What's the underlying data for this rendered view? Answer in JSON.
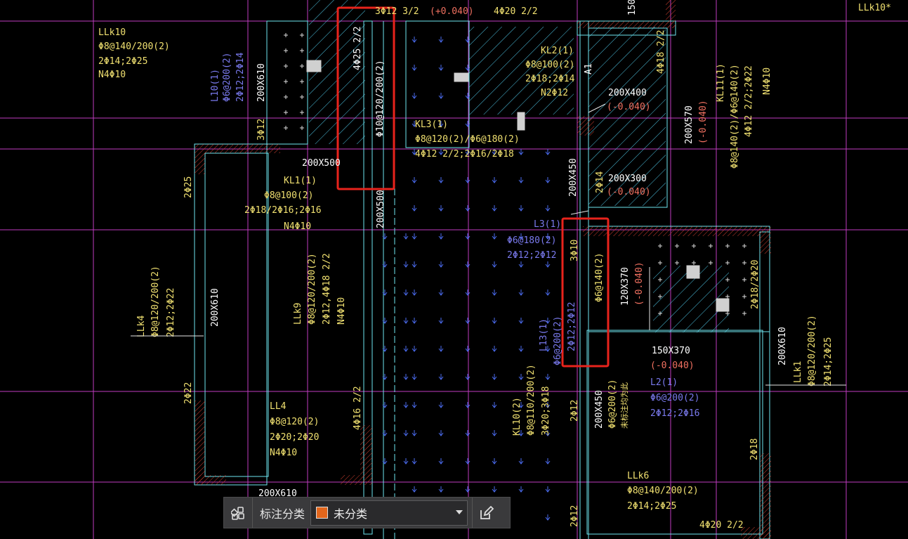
{
  "colors": {
    "background": "#000000",
    "highlight": "#e8231c",
    "category_swatch": "#e2661c"
  },
  "drawing": {
    "top_labels": {
      "left": "3Φ12 3/2",
      "mid": "(+0.040)",
      "right": "4Φ20 2/2",
      "far_right": "LLk10*"
    },
    "beams": {
      "llk10_name": "LLk10",
      "llk10_stirrup": "Φ8@140/200(2)",
      "llk10_bars": "2Φ14;2Φ25",
      "llk10_side": "N4Φ10",
      "l10_name": "L10(1)",
      "l10_stirrup": "Φ6@200(2)",
      "l10_bars": "2Φ12;2Φ14",
      "l10_size": "200X610",
      "kl2_name": "KL2(1)",
      "kl2_stirrup": "Φ8@100(2)",
      "kl2_bars": "2Φ18;2Φ14",
      "kl2_side": "N2Φ12",
      "kl2_bot": "4Φ18 2/2",
      "kl2_size": "200X400",
      "kl2_elev": "(-0.040)",
      "kl11_name": "KL11(1)",
      "kl11_stirrup": "Φ8@140(2)/Φ6@140(2)",
      "kl11_bars": "4Φ12 2/2;2Φ22",
      "kl11_side": "N4Φ10",
      "kl11_size": "200X570",
      "kl11_elev": "(-0.040)",
      "kl3_name": "KL3(1)",
      "kl3_stirrup": "Φ8@120(2)/Φ6@180(2)",
      "kl3_bars": "4Φ12 2/2;2Φ16/2Φ18",
      "hl_top_1": "4Φ25 2/2",
      "hl_top_2": "Φ10@120/200(2)",
      "size_200x500": "200X500",
      "size_200x500_v": "200X500",
      "kl1_name": "KL1(1)",
      "kl1_stirrup": "Φ8@100(2)",
      "kl1_bars": "2Φ18/2Φ16;2Φ16",
      "kl1_side": "N4Φ10",
      "size_200x450": "200X450",
      "bar_2c14": "2Φ14",
      "size_200x300": "200X300",
      "elev_300": "(-0.040)",
      "l3_name": "L3(1)",
      "l3_stirrup": "Φ6@180(2)",
      "l3_bars": "2Φ12;2Φ12",
      "hl_bot_1": "3Φ10",
      "hl_bot_2": "Φ6@140(2)",
      "size_120x370": "120X370",
      "elev_120": "(-0.040)",
      "l13_name": "L13(1)",
      "l13_stirrup": "Φ6@200(2)",
      "l13_bars": "2Φ12;2Φ12",
      "bar_2c18": "2Φ18/2Φ20",
      "size_150x370": "150X370",
      "elev_150": "(-0.040)",
      "l2_name": "L2(1)",
      "l2_stirrup": "Φ6@200(2)",
      "l2_bars": "2Φ12;2Φ16",
      "llk1_name": "LLk1",
      "llk1_stirrup": "Φ8@120/200(2)",
      "llk1_bars": "2Φ14;2Φ25",
      "llk1_size": "200X610",
      "llk4_name": "LLk4",
      "llk4_stirrup": "Φ8@120/200(2)",
      "llk4_bars": "2Φ12;2Φ22",
      "llk4_size": "200X610",
      "bar_2c25": "2Φ25",
      "bar_2c22": "2Φ22",
      "llk9_name": "LLk9",
      "llk9_stirrup": "Φ8@120/200(2)",
      "llk9_bars": "2Φ12,4Φ18 2/2",
      "llk9_side": "N4Φ10",
      "ll4_name": "LL4",
      "ll4_stirrup": "Φ8@120(2)",
      "ll4_bars": "2Φ20;2Φ20",
      "ll4_side": "N4Φ10",
      "bar_4c16": "4Φ16 2/2",
      "size_200x610_bot": "200X610",
      "kl10_name": "KL10(2)",
      "kl10_stirrup": "Φ8@110/200(2)",
      "kl10_bars": "3Φ20;3Φ18",
      "bar_2c12": "2Φ12",
      "size_200x450_b": "200X450",
      "kl10b_stirrup": "Φ6@200(2)",
      "kl10b_note": "未标注均为此",
      "bar_2c18b": "2Φ18",
      "llk6_name": "LLk6",
      "llk6_stirrup": "Φ8@140/200(2)",
      "llk6_bars": "2Φ14;2Φ25",
      "bar_4c20": "4Φ20 2/2",
      "bar_2c12b": "2Φ12",
      "bar_3c12": "3Φ12",
      "a1": "A1",
      "size_150": "150"
    }
  },
  "toolbar": {
    "grid_icon": "grid-icon",
    "label": "标注分类",
    "selected": "未分类",
    "edit_icon": "edit-icon"
  }
}
